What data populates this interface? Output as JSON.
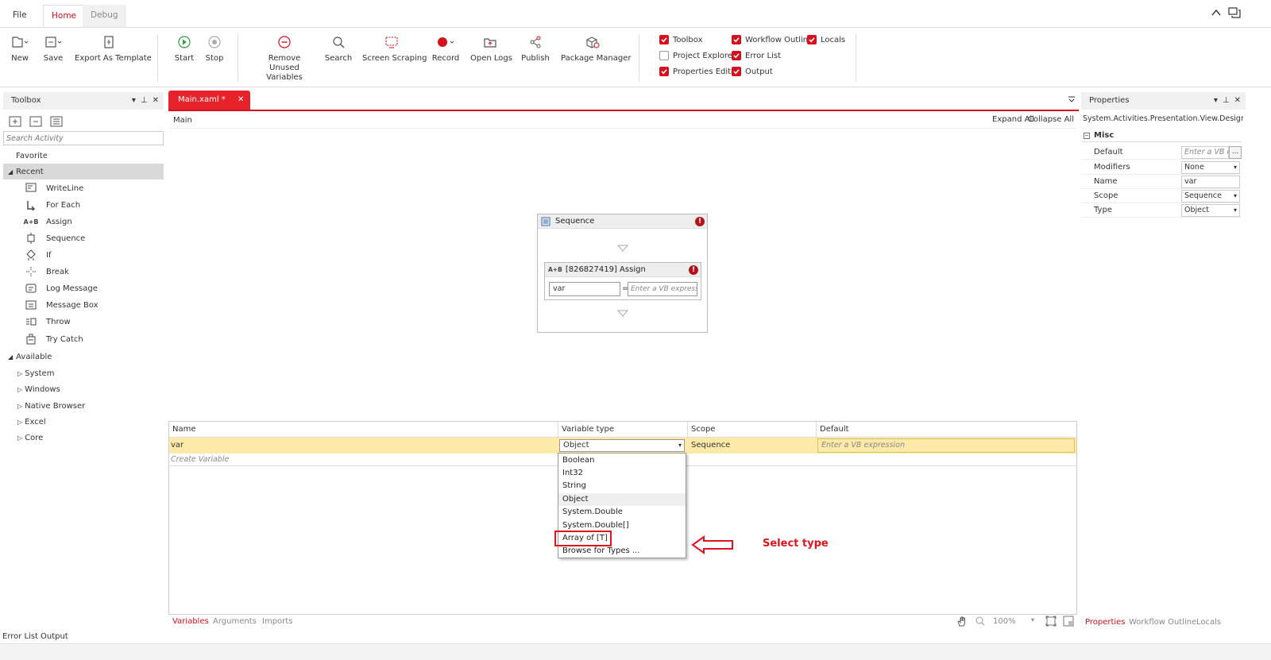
{
  "menu": {
    "tabs": [
      {
        "label": "File",
        "state": "plain"
      },
      {
        "label": "Home",
        "state": "active"
      },
      {
        "label": "Debug",
        "state": "inactive"
      }
    ]
  },
  "ribbon": {
    "buttons": [
      {
        "label": "New",
        "icon": "new-file-icon"
      },
      {
        "label": "Save",
        "icon": "save-icon"
      },
      {
        "label": "Export As Template",
        "icon": "export-template-icon"
      },
      {
        "label": "Start",
        "icon": "play-icon"
      },
      {
        "label": "Stop",
        "icon": "stop-icon"
      },
      {
        "label": "Remove Unused\nVariables",
        "icon": "remove-icon"
      },
      {
        "label": "Search",
        "icon": "search-icon"
      },
      {
        "label": "Screen Scraping",
        "icon": "screen-scraping-icon"
      },
      {
        "label": "Record",
        "icon": "record-icon"
      },
      {
        "label": "Open Logs",
        "icon": "folder-icon"
      },
      {
        "label": "Publish",
        "icon": "share-icon"
      },
      {
        "label": "Package Manager",
        "icon": "package-icon"
      }
    ],
    "panels": [
      {
        "label": "Toolbox",
        "checked": true
      },
      {
        "label": "Workflow Outline",
        "checked": true
      },
      {
        "label": "Locals",
        "checked": true
      },
      {
        "label": "Project Explorer",
        "checked": false
      },
      {
        "label": "Error List",
        "checked": true
      },
      {
        "label": "Properties Editor",
        "checked": true
      },
      {
        "label": "Output",
        "checked": true
      }
    ]
  },
  "toolbox": {
    "title": "Toolbox",
    "search_placeholder": "Search Activity",
    "favorite": "Favorite",
    "recent": "Recent",
    "recent_items": [
      {
        "label": "WriteLine",
        "icon": "writeline-icon"
      },
      {
        "label": "For Each",
        "icon": "foreach-icon"
      },
      {
        "label": "Assign",
        "icon": "assign-icon"
      },
      {
        "label": "Sequence",
        "icon": "sequence-icon"
      },
      {
        "label": "If",
        "icon": "if-icon"
      },
      {
        "label": "Break",
        "icon": "break-icon"
      },
      {
        "label": "Log Message",
        "icon": "log-message-icon"
      },
      {
        "label": "Message Box",
        "icon": "message-box-icon"
      },
      {
        "label": "Throw",
        "icon": "throw-icon"
      },
      {
        "label": "Try Catch",
        "icon": "try-catch-icon"
      }
    ],
    "available": "Available",
    "available_items": [
      "System",
      "Windows",
      "Native Browser",
      "Excel",
      "Core"
    ]
  },
  "designer": {
    "doc_tab": "Main.xaml *",
    "breadcrumb": "Main",
    "expand_all": "Expand All",
    "collapse_all": "Collapse All",
    "sequence_title": "Sequence",
    "assign_title": "[826827419] Assign",
    "assign_badge": "A+B",
    "assign_to_value": "var",
    "assign_equals": "=",
    "assign_value_placeholder": "Enter a VB expressi"
  },
  "variables": {
    "columns": [
      "Name",
      "Variable type",
      "Scope",
      "Default"
    ],
    "row": {
      "name": "var",
      "type": "Object",
      "scope": "Sequence",
      "default_placeholder": "Enter a VB expression"
    },
    "create_label": "Create Variable",
    "type_options": [
      "Boolean",
      "Int32",
      "String",
      "Object",
      "System.Double",
      "System.Double[]",
      "Array of [T]",
      "Browse for Types ..."
    ],
    "selected_option_index": 3,
    "highlighted_option_index": 6,
    "annotation": "Select type",
    "bottom_tabs": [
      "Variables",
      "Arguments",
      "Imports"
    ],
    "zoom": "100%"
  },
  "properties": {
    "title": "Properties",
    "type_name": "System.Activities.Presentation.View.Design...",
    "section": "Misc",
    "rows": [
      {
        "label": "Default",
        "value": "Enter a VB e",
        "placeholder": true,
        "button": "..."
      },
      {
        "label": "Modifiers",
        "value": "None",
        "dropdown": true
      },
      {
        "label": "Name",
        "value": "var"
      },
      {
        "label": "Scope",
        "value": "Sequence",
        "dropdown": true
      },
      {
        "label": "Type",
        "value": "Object",
        "dropdown": true
      }
    ],
    "bottom_tabs": [
      "Properties",
      "Workflow Outline",
      "Locals"
    ]
  },
  "status": {
    "tabs": [
      "Error List",
      "Output"
    ]
  },
  "colors": {
    "accent": "#d4111c",
    "row_highlight": "#fde9a8",
    "annotation": "#e0141e"
  }
}
